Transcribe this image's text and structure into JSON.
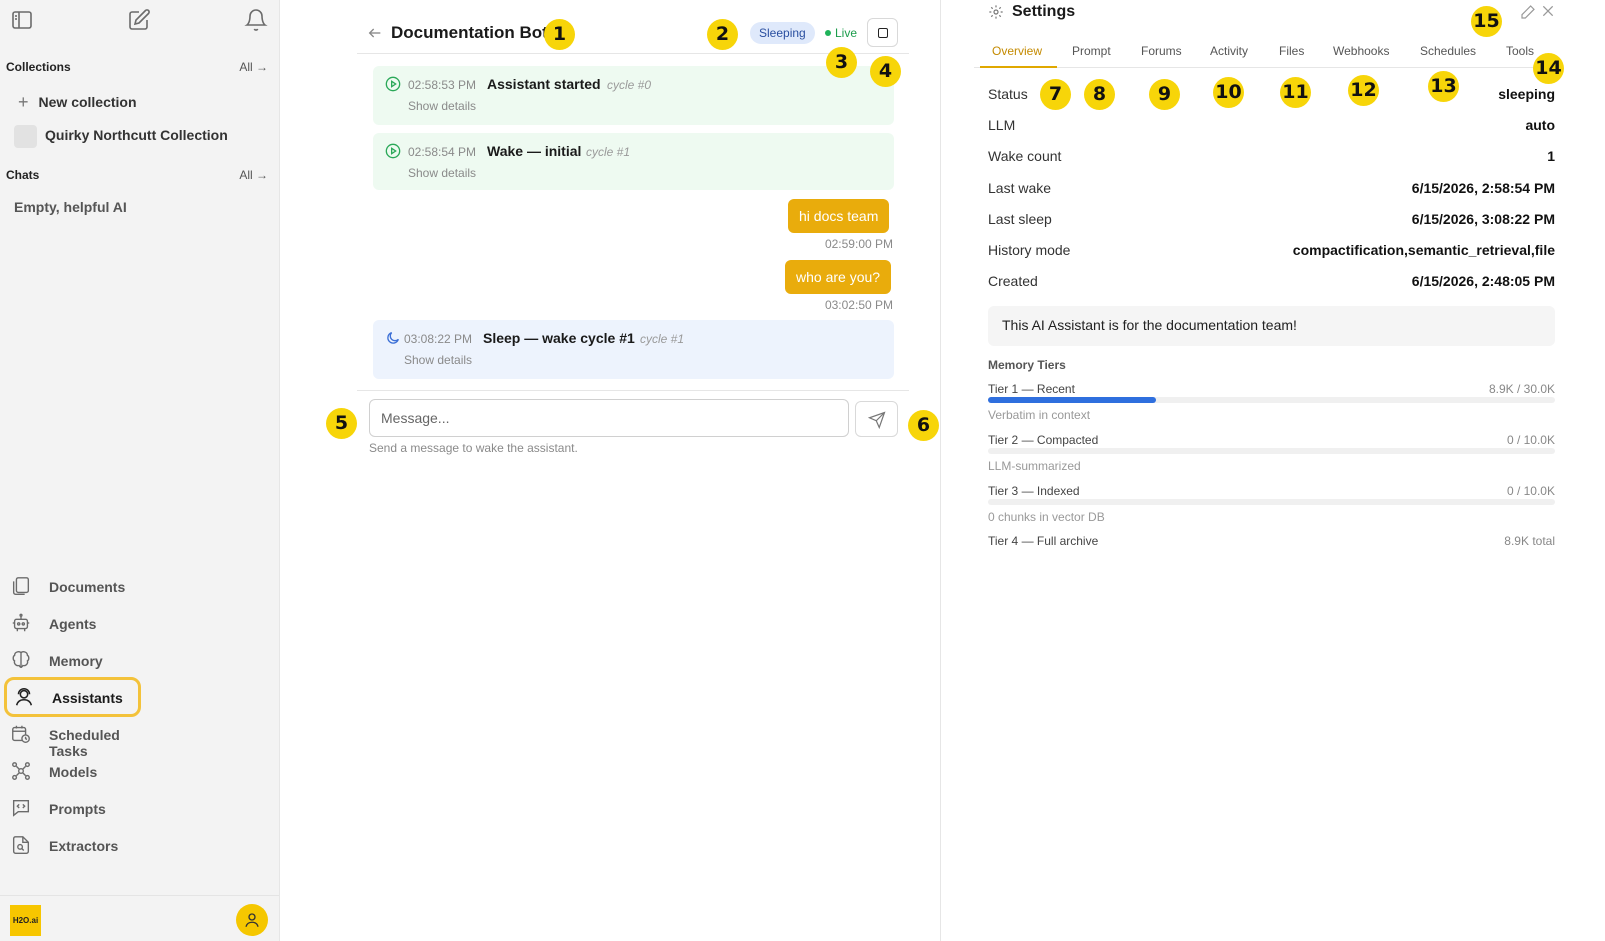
{
  "sidebar": {
    "collections_heading": "Collections",
    "all_label": "All",
    "new_collection_label": "New collection",
    "collection_name": "Quirky Northcutt Collection",
    "chats_heading": "Chats",
    "chat_item": "Empty, helpful AI",
    "nav": [
      {
        "label": "Documents",
        "icon": "documents-icon"
      },
      {
        "label": "Agents",
        "icon": "robot-icon"
      },
      {
        "label": "Memory",
        "icon": "brain-icon"
      },
      {
        "label": "Assistants",
        "icon": "assistant-icon"
      },
      {
        "label": "Scheduled Tasks",
        "icon": "calendar-clock-icon"
      },
      {
        "label": "Models",
        "icon": "network-icon"
      },
      {
        "label": "Prompts",
        "icon": "code-bubble-icon"
      },
      {
        "label": "Extractors",
        "icon": "file-search-icon"
      }
    ],
    "active_nav": "Assistants",
    "logo_text": "H2O.ai"
  },
  "chat": {
    "title": "Documentation Bot",
    "status_badge": "Sleeping",
    "live_label": "Live",
    "events": [
      {
        "time": "02:58:53 PM",
        "title": "Assistant started",
        "cycle": "cycle #0",
        "details": "Show details",
        "kind": "start"
      },
      {
        "time": "02:58:54 PM",
        "title": "Wake — initial",
        "cycle": "cycle #1",
        "details": "Show details",
        "kind": "wake"
      },
      {
        "time": "03:08:22 PM",
        "title": "Sleep — wake cycle #1",
        "cycle": "cycle #1",
        "details": "Show details",
        "kind": "sleep"
      }
    ],
    "messages": [
      {
        "text": "hi docs team",
        "time": "02:59:00 PM"
      },
      {
        "text": "who are you?",
        "time": "03:02:50 PM"
      }
    ],
    "input_placeholder": "Message...",
    "hint": "Send a message to wake the assistant."
  },
  "settings": {
    "title": "Settings",
    "tabs": [
      "Overview",
      "Prompt",
      "Forums",
      "Activity",
      "Files",
      "Webhooks",
      "Schedules",
      "Tools"
    ],
    "active_tab": "Overview",
    "rows": [
      {
        "label": "Status",
        "value": "sleeping"
      },
      {
        "label": "LLM",
        "value": "auto"
      },
      {
        "label": "Wake count",
        "value": "1"
      },
      {
        "label": "Last wake",
        "value": "6/15/2026, 2:58:54 PM"
      },
      {
        "label": "Last sleep",
        "value": "6/15/2026, 3:08:22 PM"
      },
      {
        "label": "History mode",
        "value": "compactification,semantic_retrieval,file"
      },
      {
        "label": "Created",
        "value": "6/15/2026, 2:48:05 PM"
      }
    ],
    "description": "This AI Assistant is for the documentation team!",
    "memory_title": "Memory Tiers",
    "tiers": [
      {
        "label": "Tier 1 — Recent",
        "value": "8.9K / 30.0K",
        "fraction": 0.297,
        "sub": "Verbatim in context"
      },
      {
        "label": "Tier 2 — Compacted",
        "value": "0 / 10.0K",
        "fraction": 0,
        "sub": "LLM-summarized"
      },
      {
        "label": "Tier 3 — Indexed",
        "value": "0 / 10.0K",
        "fraction": 0,
        "sub": "0 chunks in vector DB"
      },
      {
        "label": "Tier 4 — Full archive",
        "value": "8.9K total",
        "fraction": null,
        "sub": ""
      }
    ]
  },
  "markers": [
    "1",
    "2",
    "3",
    "4",
    "5",
    "6",
    "7",
    "8",
    "9",
    "10",
    "11",
    "12",
    "13",
    "14",
    "15"
  ],
  "colors": {
    "accent": "#e9ac0c",
    "marker": "#f7d509",
    "live": "#1c9c4b",
    "tier_fill": "#2f6fde"
  }
}
